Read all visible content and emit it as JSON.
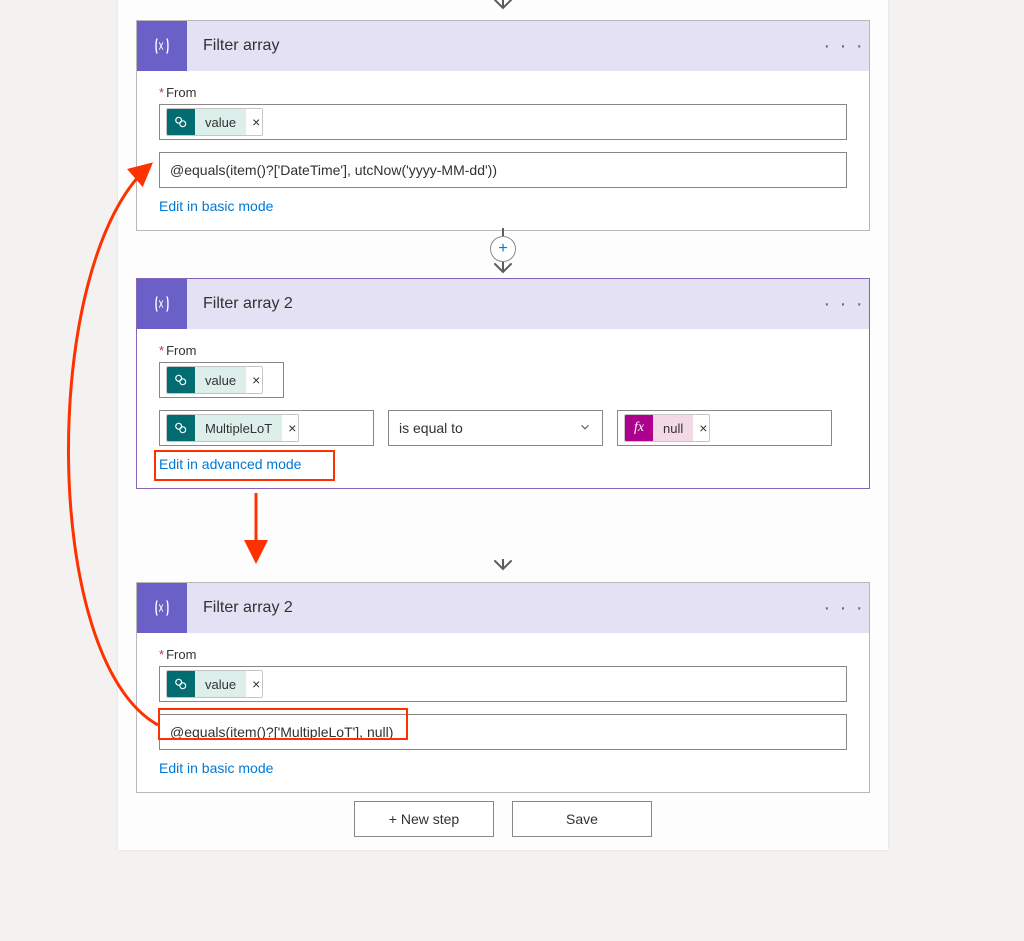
{
  "cards": {
    "c1": {
      "title": "Filter array",
      "fromLabel": "From",
      "token": "value",
      "expression": "@equals(item()?['DateTime'], utcNow('yyyy-MM-dd'))",
      "editLink": "Edit in basic mode"
    },
    "c2": {
      "title": "Filter array 2",
      "fromLabel": "From",
      "token": "value",
      "condLeft": "MultipleLoT",
      "condOp": "is equal to",
      "condRight": "null",
      "editLink": "Edit in advanced mode"
    },
    "c3": {
      "title": "Filter array 2",
      "fromLabel": "From",
      "token": "value",
      "expression": "@equals(item()?['MultipleLoT'], null)",
      "editLink": "Edit in basic mode"
    }
  },
  "buttons": {
    "newStep": "+ New step",
    "save": "Save"
  },
  "glyphs": {
    "menuDots": "· · ·",
    "plus": "+",
    "fx": "fx",
    "x": "×",
    "asterisk": "*"
  }
}
